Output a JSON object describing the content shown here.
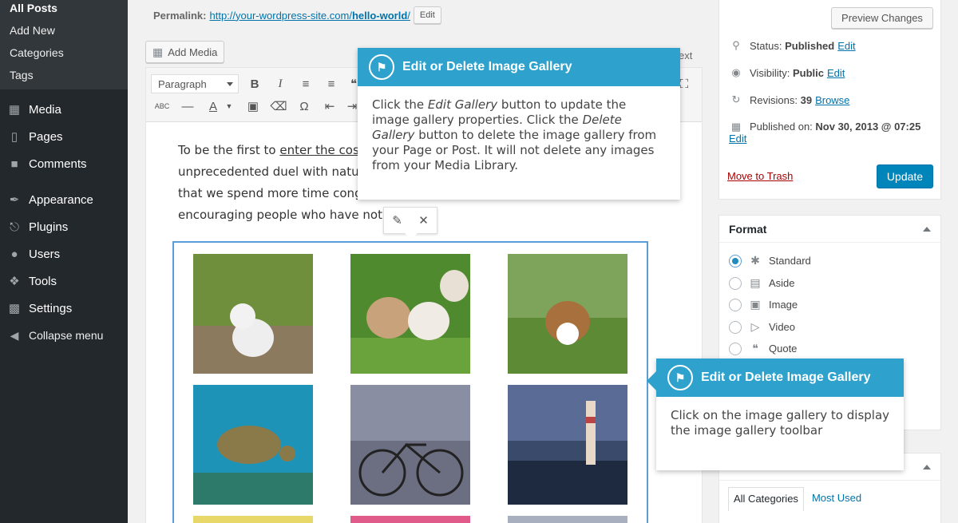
{
  "sidebar": {
    "submenu": [
      "All Posts",
      "Add New",
      "Categories",
      "Tags"
    ],
    "items": [
      {
        "label": "Media",
        "icon": "media-icon"
      },
      {
        "label": "Pages",
        "icon": "pages-icon"
      },
      {
        "label": "Comments",
        "icon": "comments-icon"
      },
      {
        "label": "Appearance",
        "icon": "appearance-icon"
      },
      {
        "label": "Plugins",
        "icon": "plugins-icon"
      },
      {
        "label": "Users",
        "icon": "users-icon"
      },
      {
        "label": "Tools",
        "icon": "tools-icon"
      },
      {
        "label": "Settings",
        "icon": "settings-icon"
      },
      {
        "label": "Collapse menu",
        "icon": "collapse-icon"
      }
    ]
  },
  "permalink": {
    "label": "Permalink:",
    "url_base": "http://your-wordpress-site.com/",
    "slug": "hello-world",
    "suffix": "/",
    "edit": "Edit"
  },
  "editor": {
    "add_media": "Add Media",
    "text_tab": "ext",
    "format": "Paragraph",
    "content": {
      "line1_pre": "To be the first to ",
      "line1_link": "enter the cos",
      "line2": "unprecedented duel with natur",
      "line3": "that we spend more time cong",
      "line4": "encouraging people who have not."
    }
  },
  "pointer_top": {
    "title": "Edit or Delete Image Gallery",
    "t1": "Click the ",
    "e1": "Edit Gallery",
    "t2": " button to update the image gallery properties. Click the ",
    "e2": "Delete Gallery",
    "t3": " button to delete the image gallery from your Page or Post. It will not delete any images from your Media Library."
  },
  "pointer_side": {
    "title": "Edit or Delete Image Gallery",
    "body": "Click on the image gallery to display the image gallery toolbar"
  },
  "publish": {
    "preview": "Preview Changes",
    "status_label": "Status:",
    "status_value": "Published",
    "status_edit": "Edit",
    "vis_label": "Visibility:",
    "vis_value": "Public",
    "vis_edit": "Edit",
    "rev_label": "Revisions:",
    "rev_value": "39",
    "rev_browse": "Browse",
    "pub_label": "Published on:",
    "pub_value": "Nov 30, 2013 @ 07:25",
    "pub_edit": "Edit",
    "trash": "Move to Trash",
    "update": "Update"
  },
  "format_box": {
    "title": "Format",
    "options": [
      {
        "label": "Standard",
        "icon": "pin-icon",
        "selected": true
      },
      {
        "label": "Aside",
        "icon": "aside-icon",
        "selected": false
      },
      {
        "label": "Image",
        "icon": "image-icon",
        "selected": false
      },
      {
        "label": "Video",
        "icon": "video-icon",
        "selected": false
      },
      {
        "label": "Quote",
        "icon": "quote-icon",
        "selected": false
      }
    ]
  },
  "categories": {
    "tab_all": "All Categories",
    "tab_used": "Most Used"
  },
  "colors": {
    "accent": "#2ea2cc",
    "admin_bar": "#23282d",
    "primary_button": "#0085ba",
    "link": "#0073aa"
  }
}
